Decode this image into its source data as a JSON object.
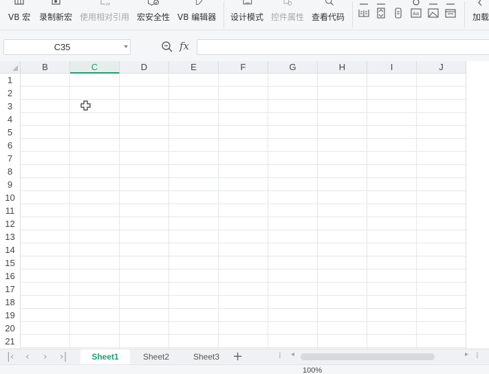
{
  "ribbon": {
    "items": [
      {
        "id": "vb-macro",
        "label": "VB 宏",
        "icon": "vb-macro-icon",
        "disabled": false
      },
      {
        "id": "record-macro",
        "label": "录制新宏",
        "icon": "record-macro-icon",
        "disabled": false
      },
      {
        "id": "relative-ref",
        "label": "使用相对引用",
        "icon": "relative-reference-icon",
        "disabled": true
      },
      {
        "id": "macro-security",
        "label": "宏安全性",
        "icon": "shield-icon",
        "disabled": false
      },
      {
        "id": "vb-editor",
        "label": "VB 编辑器",
        "icon": "vb-editor-icon",
        "disabled": false
      },
      {
        "id": "design-mode",
        "label": "设计模式",
        "icon": "design-mode-icon",
        "disabled": false
      },
      {
        "id": "control-props",
        "label": "控件属性",
        "icon": "control-properties-icon",
        "disabled": true
      },
      {
        "id": "view-code",
        "label": "查看代码",
        "icon": "view-code-icon",
        "disabled": false
      },
      {
        "id": "addin",
        "label": "加载",
        "icon": "addin-icon",
        "disabled": false
      }
    ]
  },
  "formula_bar": {
    "name_box": "C35",
    "fx_label": "fx",
    "formula": ""
  },
  "grid": {
    "columns": [
      "B",
      "C",
      "D",
      "E",
      "F",
      "G",
      "H",
      "I",
      "J"
    ],
    "active_column": "C",
    "rows": [
      "1",
      "2",
      "3",
      "4",
      "5",
      "6",
      "7",
      "8",
      "9",
      "10",
      "11",
      "12",
      "13",
      "14",
      "15",
      "16",
      "17",
      "18",
      "19",
      "20",
      "21"
    ]
  },
  "sheets": {
    "tabs": [
      "Sheet1",
      "Sheet2",
      "Sheet3"
    ],
    "active": "Sheet1",
    "add_label": "+"
  },
  "status": {
    "zoom": "100%"
  },
  "colors": {
    "accent": "#1d9e6e",
    "gridline": "#e3e6ea",
    "header_bg": "#eef0f3"
  }
}
